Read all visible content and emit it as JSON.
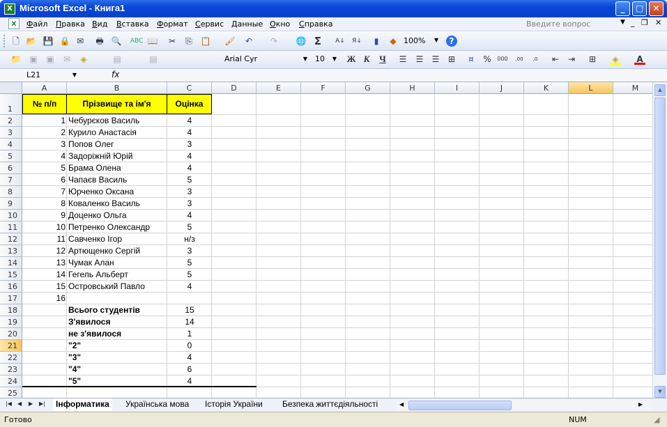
{
  "window": {
    "title": "Microsoft Excel - Книга1"
  },
  "menu": [
    "Файл",
    "Правка",
    "Вид",
    "Вставка",
    "Формат",
    "Сервис",
    "Данные",
    "Окно",
    "Справка"
  ],
  "question_box": {
    "placeholder": "Введите вопрос"
  },
  "toolbar": {
    "zoom": "100%",
    "font_name": "Arial Cyr",
    "font_size": "10",
    "bold": "Ж",
    "italic": "К",
    "underline": "Ч"
  },
  "formula_bar": {
    "name_box": "L21",
    "fx": "fx",
    "value": ""
  },
  "columns": [
    "A",
    "B",
    "C",
    "D",
    "E",
    "F",
    "G",
    "H",
    "I",
    "J",
    "K",
    "L",
    "M"
  ],
  "selected_column": "L",
  "rows": [
    "1",
    "2",
    "3",
    "4",
    "5",
    "6",
    "7",
    "8",
    "9",
    "10",
    "11",
    "12",
    "13",
    "14",
    "15",
    "16",
    "17",
    "18",
    "19",
    "20",
    "21",
    "22",
    "23",
    "24",
    "25"
  ],
  "selected_row": "21",
  "table": {
    "headers": [
      "№ п/п",
      "Прізвище та ім'я",
      "Оцінка"
    ],
    "students": [
      {
        "n": "1",
        "name": "Чебурєков Василь",
        "grade": "4"
      },
      {
        "n": "2",
        "name": "Курило Анастасія",
        "grade": "4"
      },
      {
        "n": "3",
        "name": "Попов Олег",
        "grade": "3"
      },
      {
        "n": "4",
        "name": "Задоріжній Юрій",
        "grade": "4"
      },
      {
        "n": "5",
        "name": "Брама Олена",
        "grade": "4"
      },
      {
        "n": "6",
        "name": "Чапаєв Василь",
        "grade": "5"
      },
      {
        "n": "7",
        "name": "Юрченко Оксана",
        "grade": "3"
      },
      {
        "n": "8",
        "name": "Коваленко Василь",
        "grade": "3"
      },
      {
        "n": "9",
        "name": "Доценко Ольга",
        "grade": "4"
      },
      {
        "n": "10",
        "name": "Петренко Олександр",
        "grade": "5"
      },
      {
        "n": "11",
        "name": "Савченко Ігор",
        "grade": "н/з"
      },
      {
        "n": "12",
        "name": "Артющенко Сергій",
        "grade": "3"
      },
      {
        "n": "13",
        "name": "Чумак Алан",
        "grade": "5"
      },
      {
        "n": "14",
        "name": "Гегель Альберт",
        "grade": "5"
      },
      {
        "n": "15",
        "name": "Островський Павло",
        "grade": "4"
      }
    ],
    "row17_n": "16",
    "summary": [
      {
        "label": "Всього студентів",
        "value": "15",
        "bold": true
      },
      {
        "label": "З'явилося",
        "value": "14",
        "bold": true
      },
      {
        "label": "не з'явилося",
        "value": "1",
        "bold": true
      },
      {
        "label": "\"2\"",
        "value": "0",
        "bold": true
      },
      {
        "label": "\"3\"",
        "value": "4",
        "bold": true
      },
      {
        "label": "\"4\"",
        "value": "6",
        "bold": true
      },
      {
        "label": "\"5\"",
        "value": "4",
        "bold": true
      }
    ]
  },
  "sheet_tabs": [
    "Інформатика",
    "Українська мова",
    "Історія України",
    "Безпека життєдіяльності"
  ],
  "active_tab": "Інформатика",
  "status": {
    "ready": "Готово",
    "num": "NUM"
  }
}
